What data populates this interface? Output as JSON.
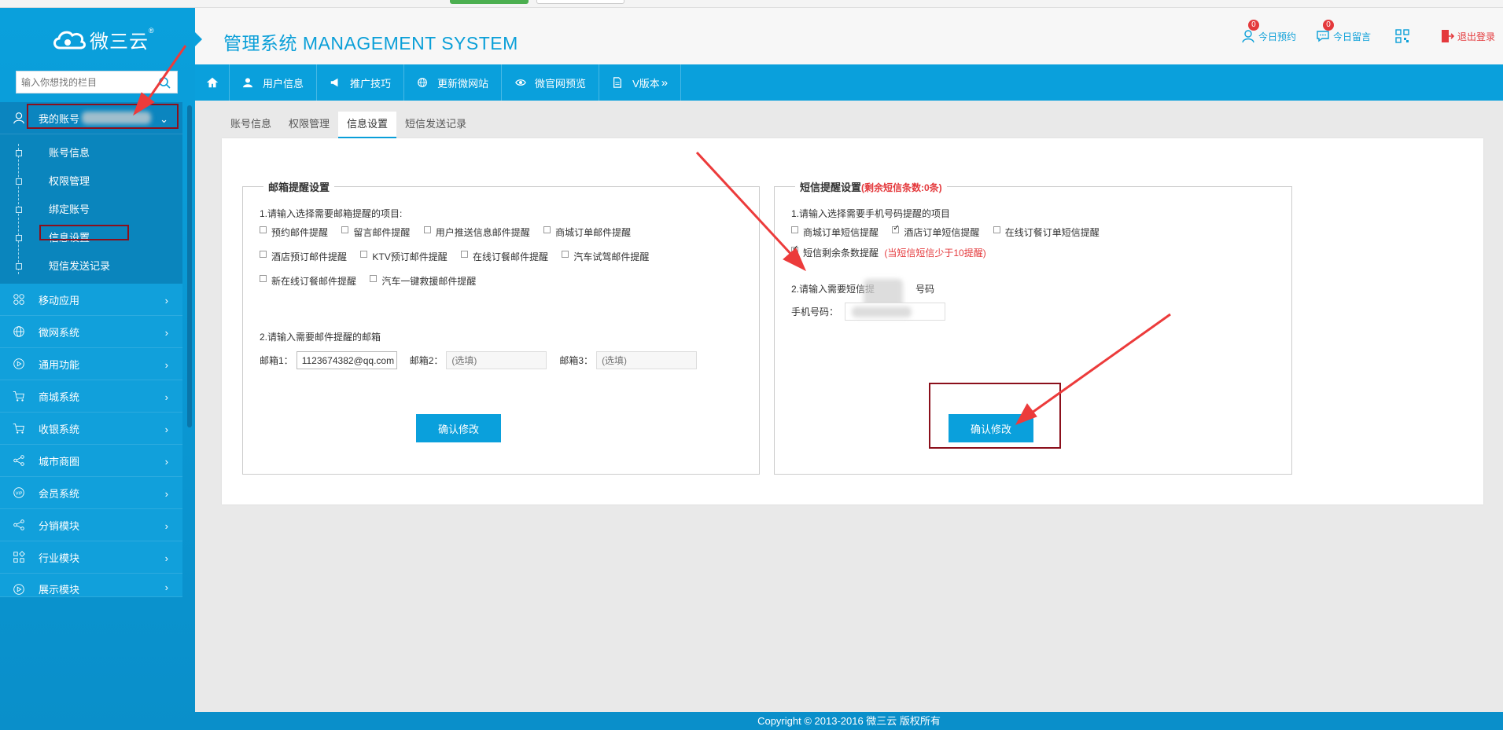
{
  "brand": {
    "name": "微三云",
    "tm": "®"
  },
  "search": {
    "placeholder": "输入你想找的栏目"
  },
  "header": {
    "title": "管理系统 MANAGEMENT SYSTEM",
    "items": [
      {
        "label": "今日预约",
        "badge": "0"
      },
      {
        "label": "今日留言",
        "badge": "0"
      },
      {
        "label": "退出登录"
      }
    ]
  },
  "sidebar": {
    "account": {
      "label": "我的账号"
    },
    "sub_items": [
      "账号信息",
      "权限管理",
      "绑定账号",
      "信息设置",
      "短信发送记录"
    ],
    "items": [
      "移动应用",
      "微网系统",
      "通用功能",
      "商城系统",
      "收银系统",
      "城市商圈",
      "会员系统",
      "分销模块",
      "行业模块",
      "展示模块"
    ]
  },
  "topnav": {
    "items": [
      "用户信息",
      "推广技巧",
      "更新微网站",
      "微官网预览",
      "V版本"
    ]
  },
  "tabs": [
    "账号信息",
    "权限管理",
    "信息设置",
    "短信发送记录"
  ],
  "email_box": {
    "legend": "邮箱提醒设置",
    "step1": "1.请输入选择需要邮箱提醒的项目:",
    "options": [
      [
        "预约邮件提醒",
        "留言邮件提醒",
        "用户推送信息邮件提醒",
        "商城订单邮件提醒"
      ],
      [
        "酒店预订邮件提醒",
        "KTV预订邮件提醒",
        "在线订餐邮件提醒",
        "汽车试驾邮件提醒"
      ],
      [
        "新在线订餐邮件提醒",
        "汽车一键救援邮件提醒"
      ]
    ],
    "step2": "2.请输入需要邮件提醒的邮箱",
    "email1_label": "邮箱1：",
    "email1_value": "1123674382@qq.com",
    "email2_label": "邮箱2：",
    "email2_placeholder": "(选填)",
    "email3_label": "邮箱3：",
    "email3_placeholder": "(选填)",
    "submit": "确认修改"
  },
  "sms_box": {
    "legend": "短信提醒设置",
    "legend_note": "(剩余短信条数:0条)",
    "step1": "1.请输入选择需要手机号码提醒的项目",
    "options": [
      {
        "label": "商城订单短信提醒",
        "checked": false
      },
      {
        "label": "酒店订单短信提醒",
        "checked": true
      },
      {
        "label": "在线订餐订单短信提醒",
        "checked": false
      }
    ],
    "remain_label": "短信剩余条数提醒",
    "remain_note": "(当短信短信少于10提醒)",
    "step2_a": "2.请输入需要短信提",
    "step2_b": "号码",
    "phone_label": "手机号码：",
    "submit": "确认修改"
  },
  "footer": {
    "text": "Copyright © 2013-2016    微三云 版权所有"
  },
  "colors": {
    "primary": "#0aa0dc",
    "dark": "#0a85bd",
    "alert": "#e4393c",
    "highlight_box": "#8b0f1b"
  }
}
